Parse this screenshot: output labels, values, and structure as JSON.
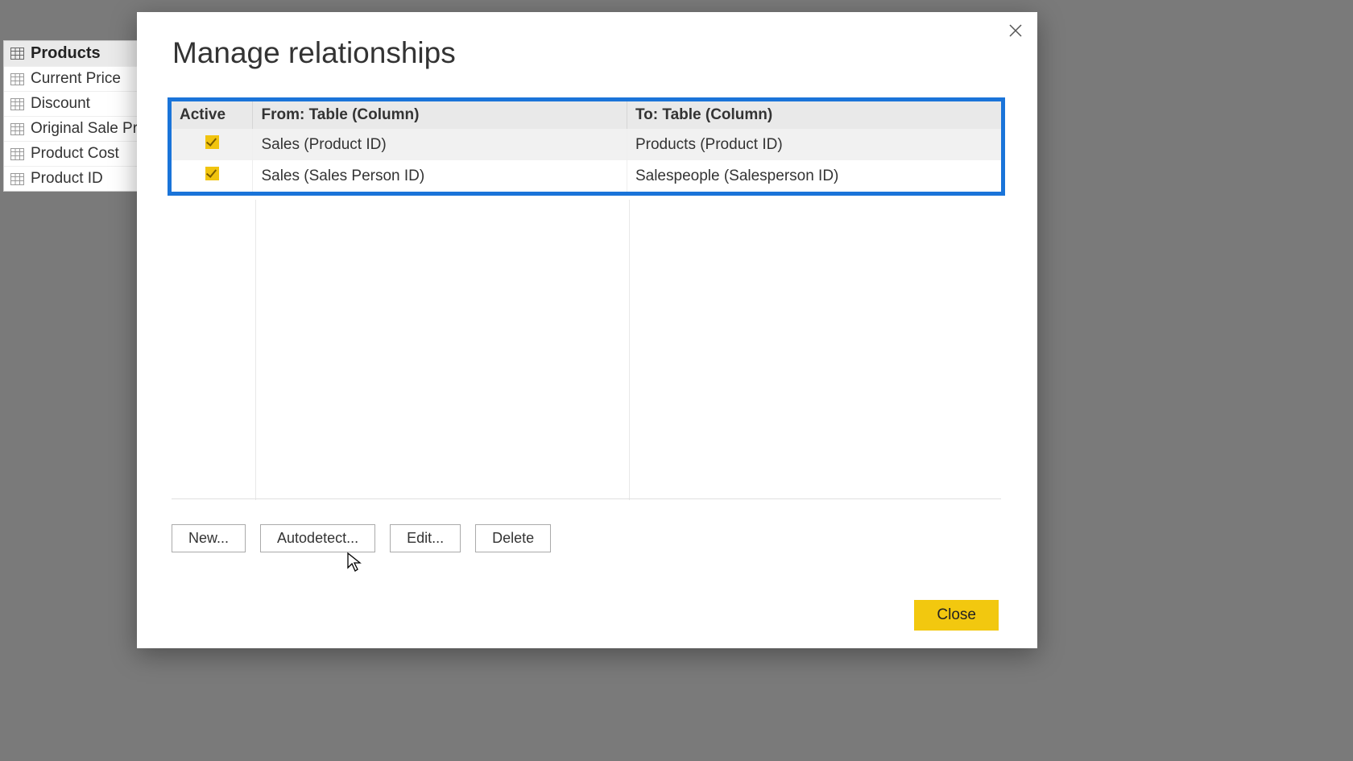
{
  "fields": {
    "table_name": "Products",
    "columns": [
      "Current Price",
      "Discount",
      "Original Sale Pri",
      "Product Cost",
      "Product ID"
    ]
  },
  "dialog": {
    "title": "Manage relationships",
    "headers": {
      "active": "Active",
      "from": "From: Table (Column)",
      "to": "To: Table (Column)"
    },
    "rows": [
      {
        "active": true,
        "from": "Sales (Product ID)",
        "to": "Products (Product ID)"
      },
      {
        "active": true,
        "from": "Sales (Sales Person ID)",
        "to": "Salespeople (Salesperson ID)"
      }
    ],
    "buttons": {
      "new": "New...",
      "autodetect": "Autodetect...",
      "edit": "Edit...",
      "delete": "Delete",
      "close": "Close"
    }
  }
}
